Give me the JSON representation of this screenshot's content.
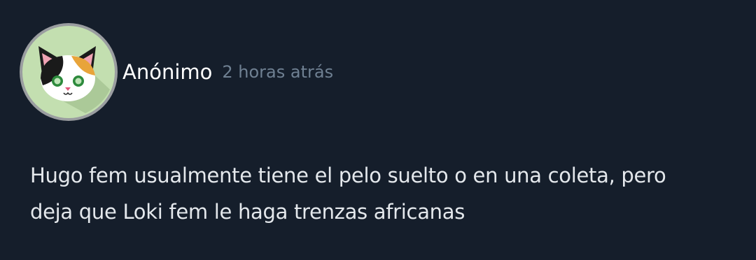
{
  "post": {
    "author": "Anónimo",
    "timestamp": "2 horas atrás",
    "avatar_icon": "calico-cat-avatar-icon",
    "body_lines": [
      "Hugo fem usualmente tiene el pelo suelto o en una coleta, pero",
      "deja que Loki fem le haga trenzas africanas"
    ]
  },
  "colors": {
    "background": "#151e2b",
    "author_text": "#ffffff",
    "timestamp_text": "#6f8092",
    "body_text": "#e4e8ec",
    "avatar_bg": "#c3dfb0"
  }
}
